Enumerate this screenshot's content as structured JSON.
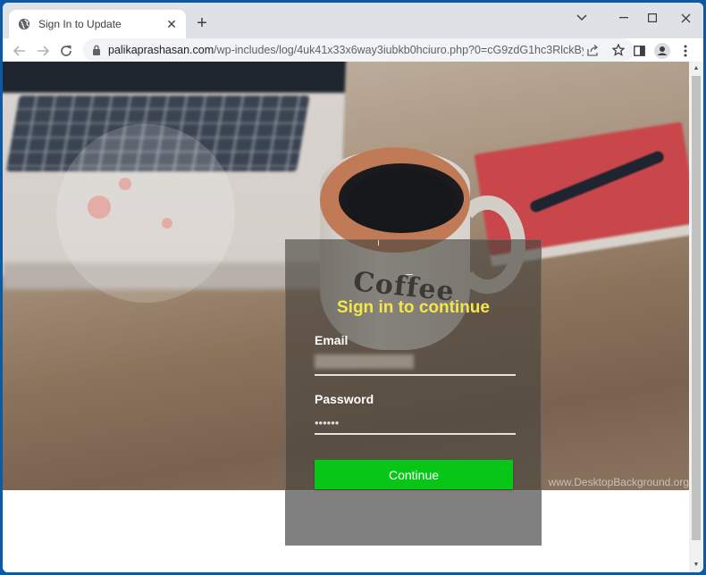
{
  "browser": {
    "tab": {
      "title": "Sign In to Update",
      "icon": "globe-icon"
    },
    "new_tab_label": "+",
    "window_controls": {
      "tab_search": "⌄",
      "minimize": "—",
      "maximize": "☐",
      "close": "✕"
    },
    "url": {
      "host": "palikaprashasan.com",
      "path": "/wp-includes/log/4uk41x33x6way3iubkb0hciuro.php?0=cG9zdG1hc3RlckByY3M..."
    }
  },
  "page": {
    "background_credit": "www.DesktopBackground.org",
    "mug_text": "Coffee",
    "login": {
      "title": "Sign in to continue",
      "email_label": "Email",
      "email_value": "",
      "password_label": "Password",
      "password_value": "••••••",
      "continue_label": "Continue"
    }
  },
  "colors": {
    "title_yellow": "#f4e64a",
    "button_green": "#07c617",
    "desktop_blue": "#0b5aa5"
  }
}
